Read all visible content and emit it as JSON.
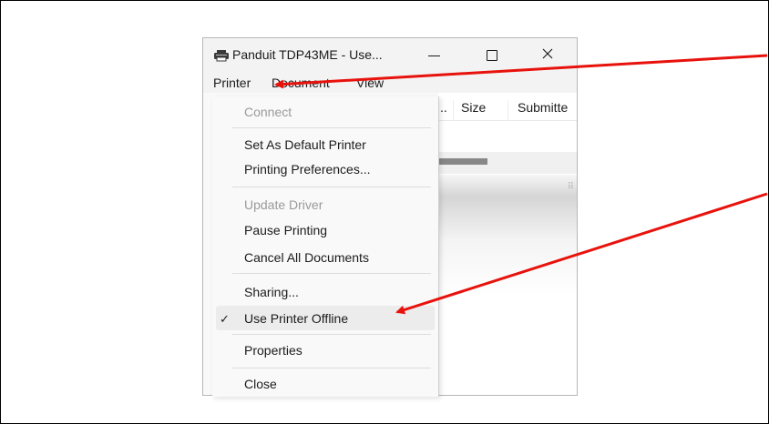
{
  "window": {
    "title": "Panduit TDP43ME  - Use...",
    "minimize_glyph": "—",
    "close_glyph": "✕",
    "icon": "printer-icon"
  },
  "menubar": {
    "printer": "Printer",
    "document": "Document",
    "view": "View"
  },
  "columns": {
    "ellipsis": "..",
    "size": "Size",
    "submitted": "Submitte"
  },
  "menu": {
    "connect": "Connect",
    "set_default": "Set As Default Printer",
    "printing_prefs": "Printing Preferences...",
    "update_driver": "Update Driver",
    "pause": "Pause Printing",
    "cancel_all": "Cancel All Documents",
    "sharing": "Sharing...",
    "offline": "Use Printer Offline",
    "offline_check": "✓",
    "properties": "Properties",
    "close": "Close"
  },
  "colors": {
    "annotation_arrow": "#e8120c"
  }
}
